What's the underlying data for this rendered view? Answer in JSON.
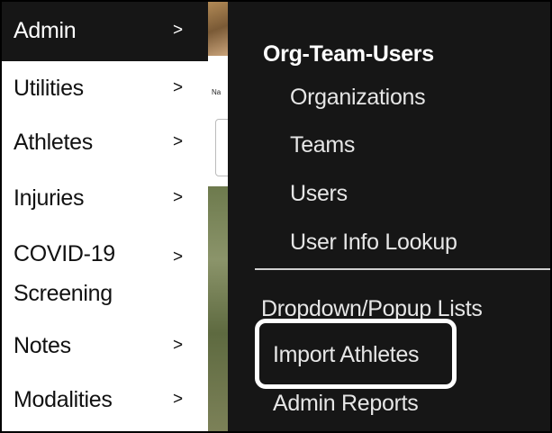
{
  "side_menu": {
    "items": [
      {
        "label": "Admin",
        "arrow": ">"
      },
      {
        "label": "Utilities",
        "arrow": ">"
      },
      {
        "label": "Athletes",
        "arrow": ">"
      },
      {
        "label": "Injuries",
        "arrow": ">"
      },
      {
        "label": "COVID-19",
        "label2": "Screening",
        "arrow": ">"
      },
      {
        "label": "Notes",
        "arrow": ">"
      },
      {
        "label": "Modalities",
        "arrow": ">"
      }
    ]
  },
  "background_page": {
    "fragment_text": "Na"
  },
  "flyout": {
    "heading": "Org-Team-Users",
    "group_items": [
      "Organizations",
      "Teams",
      "Users",
      "User Info Lookup"
    ],
    "other_items": [
      "Dropdown/Popup Lists",
      "Import Athletes",
      "Admin Reports"
    ],
    "highlighted_item": "Import Athletes"
  },
  "colors": {
    "menu_dark": "#161616",
    "highlight_border": "#ffffff"
  }
}
